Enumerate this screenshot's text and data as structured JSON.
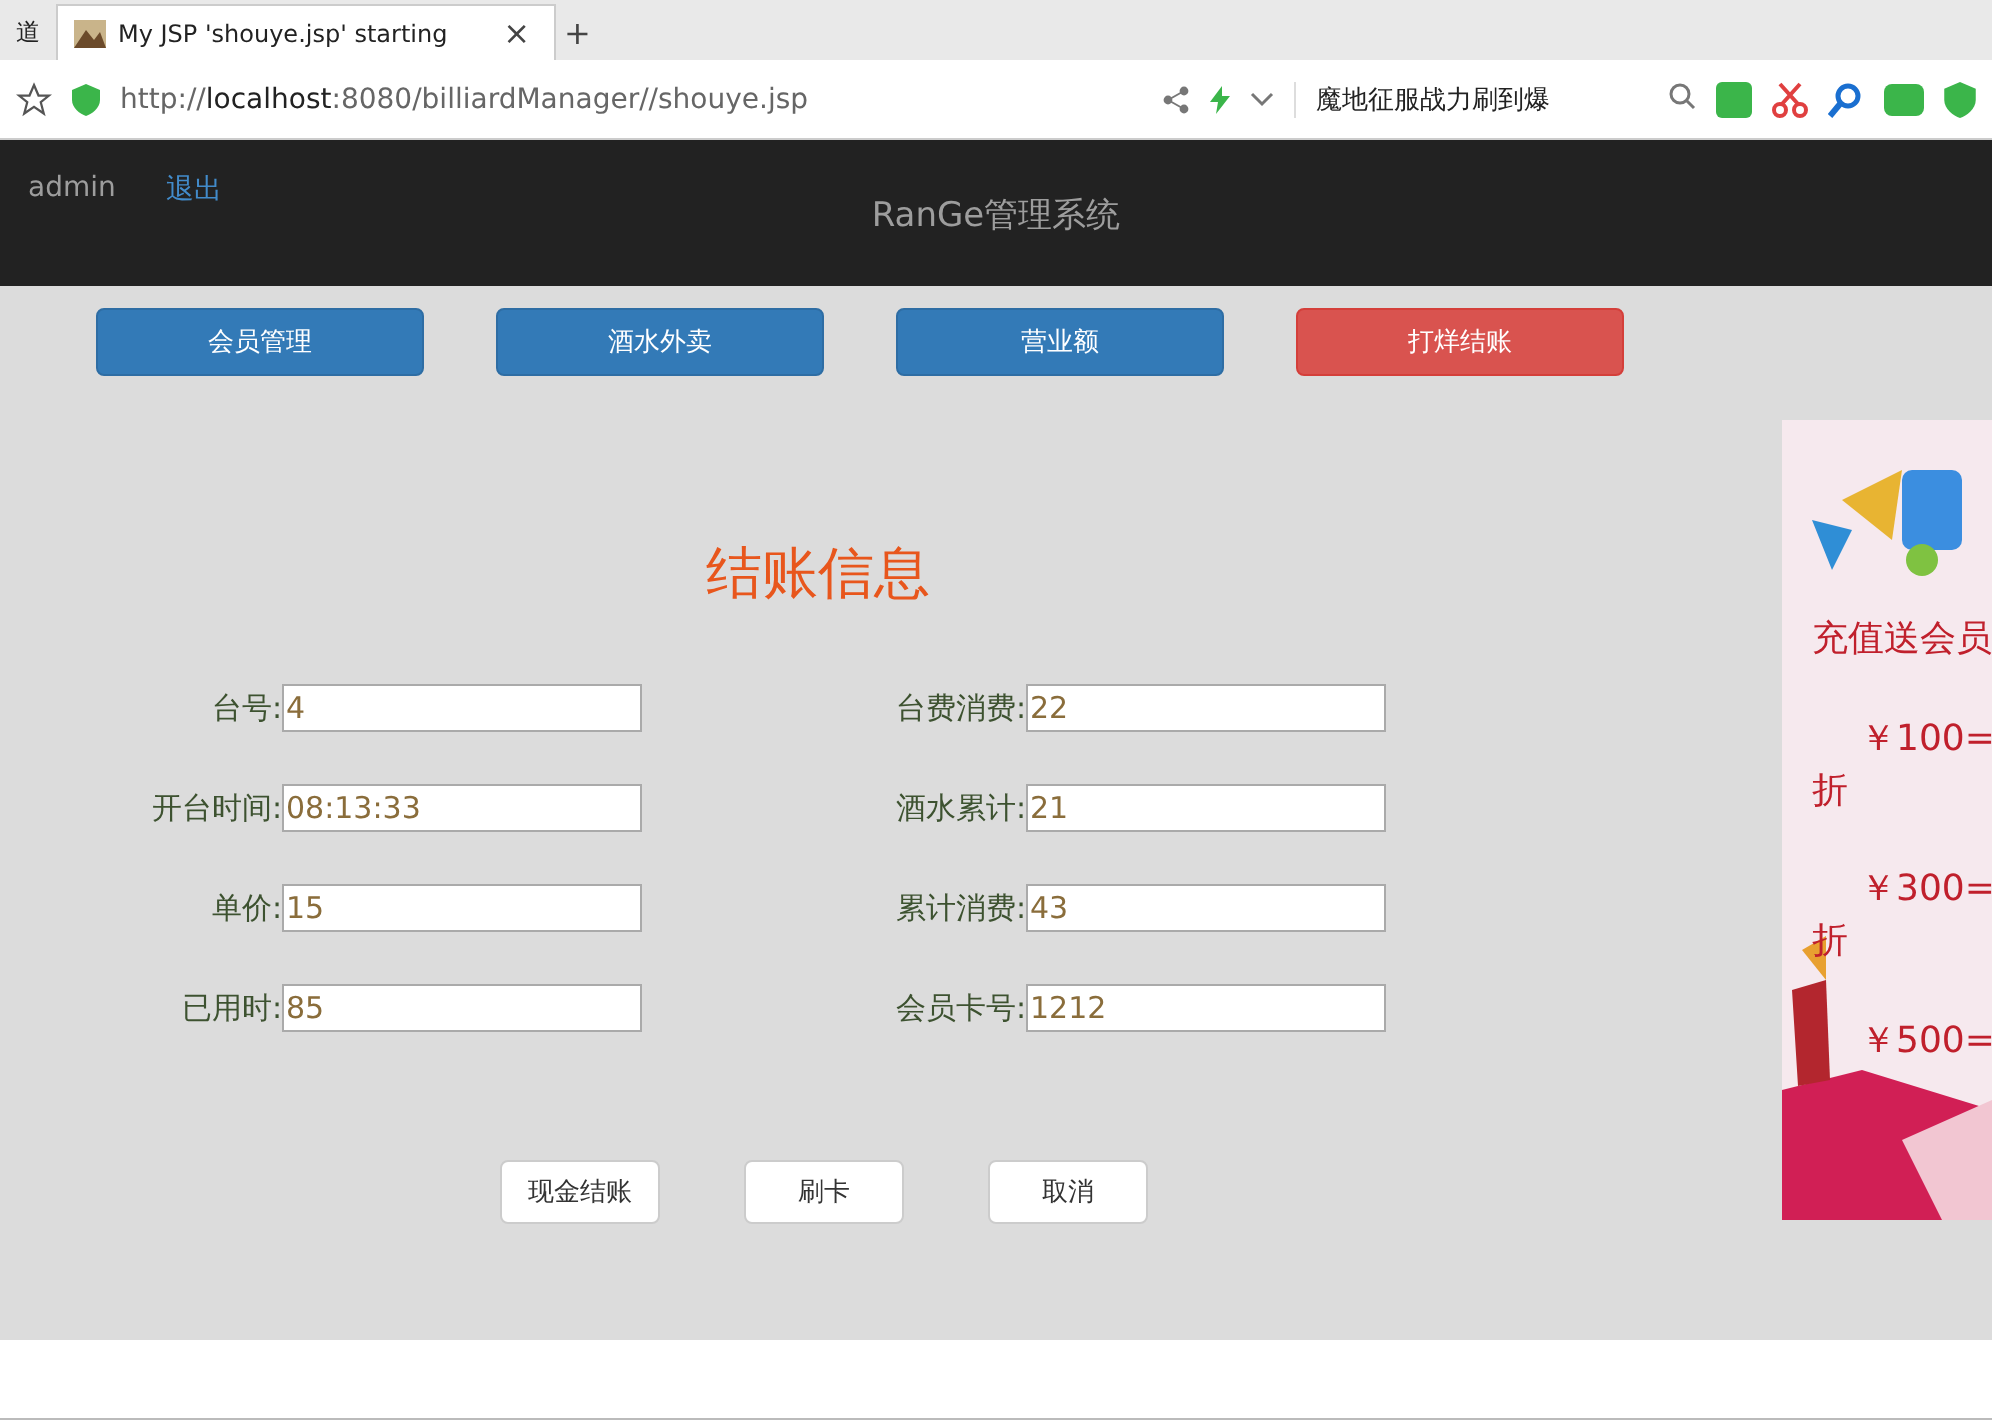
{
  "browser": {
    "tabs": [
      {
        "label": "道",
        "selected": false
      },
      {
        "label": "My JSP 'shouye.jsp' starting",
        "selected": true
      }
    ],
    "new_tab": "+",
    "close_tab": "×",
    "url": "http://**localhost**:8080/billiardManager//shouye.jsp",
    "search_value": "魔地征服战力刷到爆"
  },
  "header": {
    "user": "admin",
    "logout": "退出",
    "title": "RanGe管理系统"
  },
  "nav": [
    {
      "label": "会员管理",
      "kind": "primary"
    },
    {
      "label": "酒水外卖",
      "kind": "primary"
    },
    {
      "label": "营业额",
      "kind": "primary"
    },
    {
      "label": "打烊结账",
      "kind": "danger"
    }
  ],
  "form": {
    "title": "结账信息",
    "fields": [
      {
        "label": "台号:",
        "value": "4"
      },
      {
        "label": "台费消费:",
        "value": "22"
      },
      {
        "label": "开台时间:",
        "value": "08:13:33"
      },
      {
        "label": "酒水累计:",
        "value": "21"
      },
      {
        "label": "单价:",
        "value": "15"
      },
      {
        "label": "累计消费:",
        "value": "43"
      },
      {
        "label": "已用时:",
        "value": "85"
      },
      {
        "label": "会员卡号:",
        "value": "1212"
      }
    ],
    "buttons": [
      "现金结账",
      "刷卡",
      "取消"
    ]
  },
  "ad": {
    "kind": "picture",
    "lines": [
      "充值送会员",
      "￥100=",
      "折",
      "￥300=",
      "折",
      "￥500="
    ]
  }
}
